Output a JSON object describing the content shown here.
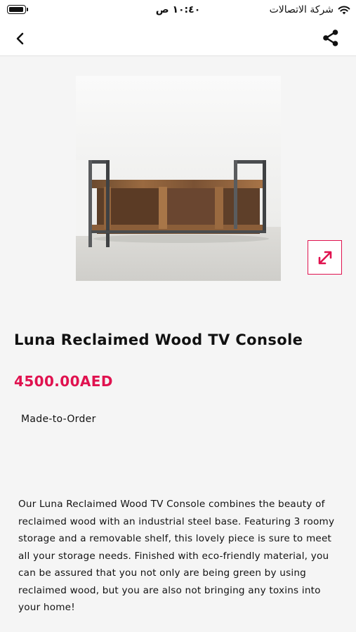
{
  "status_bar": {
    "time": "١٠:٤٠ ص",
    "carrier": "شركة الاتصالات",
    "wifi_icon": "wifi-icon",
    "battery_icon": "battery-icon"
  },
  "nav": {
    "back_icon": "chevron-left-icon",
    "share_icon": "share-icon"
  },
  "product": {
    "image_alt": "Luna Reclaimed Wood TV Console",
    "expand_icon": "expand-arrows-icon",
    "title": "Luna Reclaimed Wood TV Console",
    "price": "4500.00AED",
    "availability": "Made-to-Order",
    "description": "Our Luna Reclaimed Wood TV Console combines the beauty of reclaimed wood with an industrial steel base. Featuring 3 roomy storage and a removable shelf, this lovely piece is sure to meet all your storage needs. Finished with eco-friendly material, you can be assured that you not only are being green by using reclaimed wood, but you are also not bringing any toxins into your home!"
  },
  "colors": {
    "accent": "#e0124f",
    "background": "#f5f5f5"
  }
}
